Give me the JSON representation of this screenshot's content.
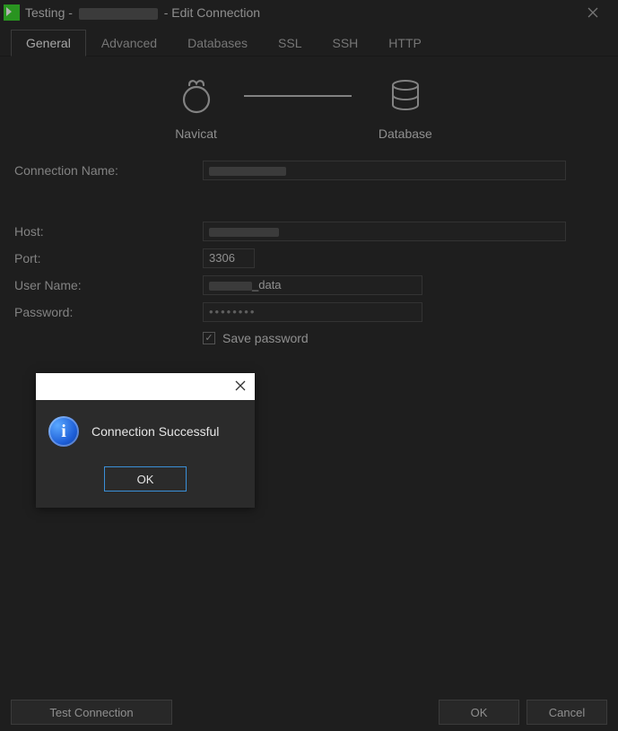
{
  "window": {
    "title_prefix": "Testing - ",
    "title_suffix": " - Edit Connection"
  },
  "tabs": {
    "general": "General",
    "advanced": "Advanced",
    "databases": "Databases",
    "ssl": "SSL",
    "ssh": "SSH",
    "http": "HTTP"
  },
  "logos": {
    "left": "Navicat",
    "right": "Database"
  },
  "labels": {
    "conn_name": "Connection Name:",
    "host": "Host:",
    "port": "Port:",
    "user": "User Name:",
    "password": "Password:",
    "save_password": "Save password"
  },
  "fields": {
    "conn_name": "",
    "host": "",
    "port": "3306",
    "user_suffix": "_data",
    "password": "••••••••"
  },
  "footer": {
    "test": "Test Connection",
    "ok": "OK",
    "cancel": "Cancel"
  },
  "modal": {
    "message": "Connection Successful",
    "ok": "OK"
  }
}
